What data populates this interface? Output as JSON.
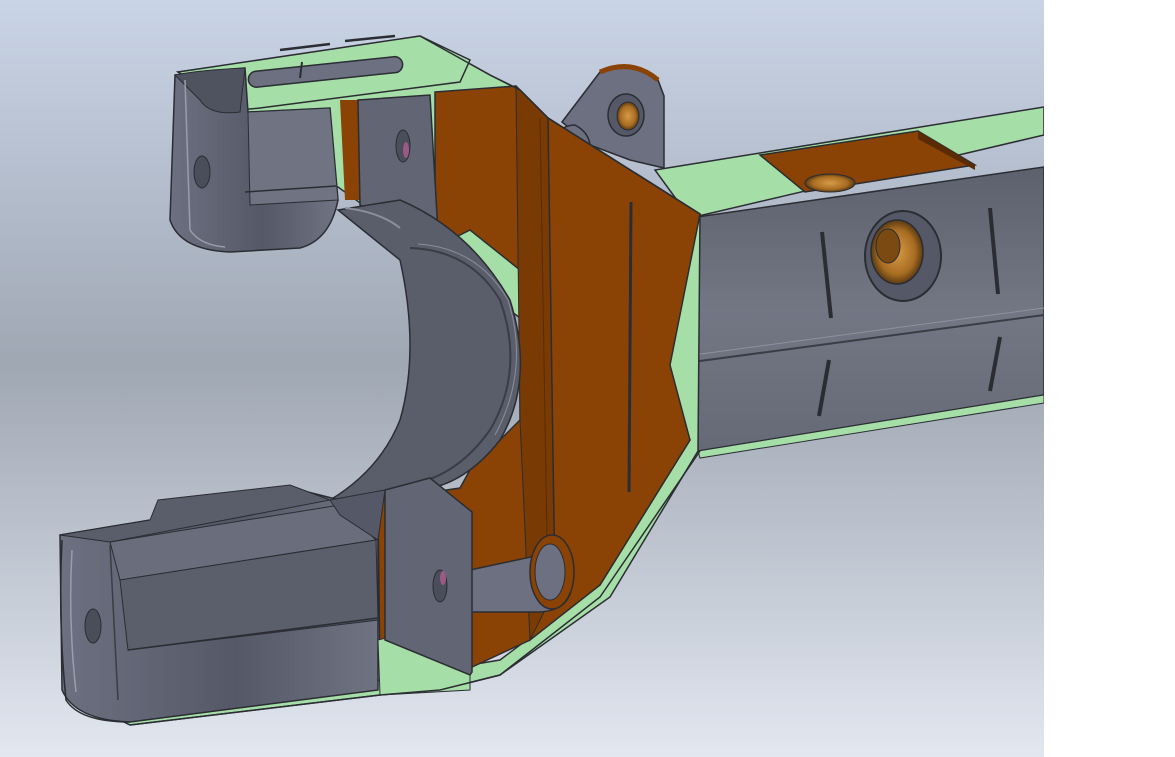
{
  "viewport": {
    "background_top": "#c9d4e6",
    "background_mid": "#9fa7b3",
    "background_bottom": "#e2e7f0"
  },
  "model": {
    "name_icon": "axle-housing-part",
    "colors": {
      "body_gray": "#6c7080",
      "body_gray_dark": "#565a66",
      "body_gray_light": "#8a8e9b",
      "plate_orange": "#8a4304",
      "plate_orange_dark": "#6e3503",
      "plate_green": "#a6dea8",
      "plate_green_edge": "#5d8e5f",
      "edge_dark": "#2b2d33",
      "hole_pink": "#9b5a86",
      "bronze": "#b87a2a"
    }
  }
}
